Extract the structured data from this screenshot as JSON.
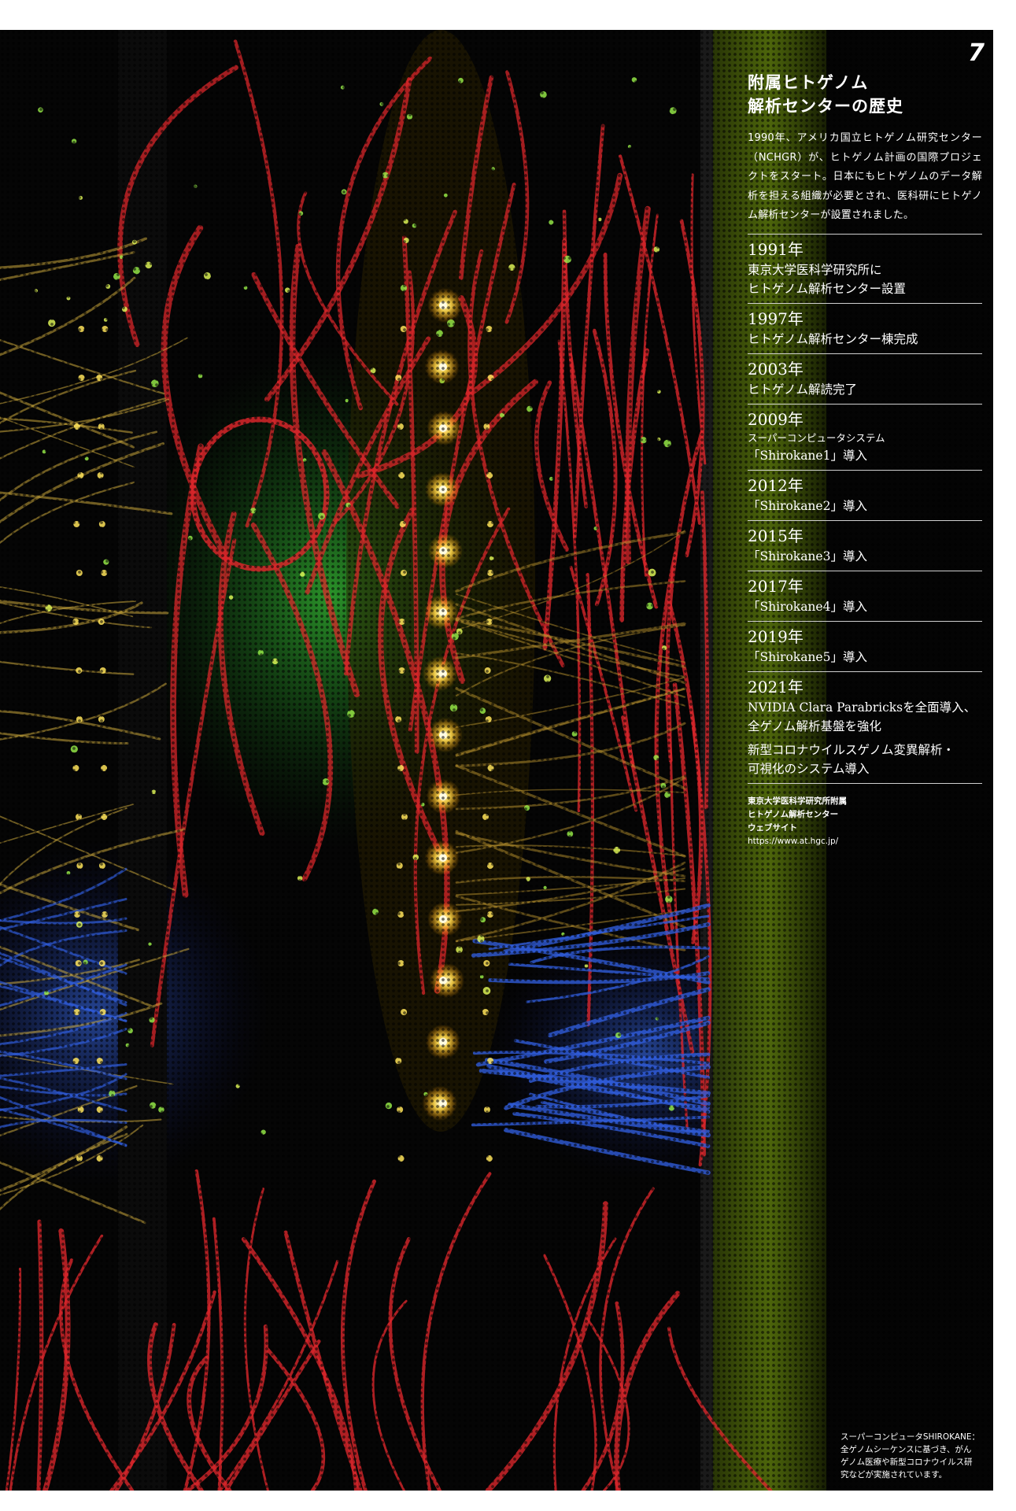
{
  "page_number": "7",
  "panel": {
    "title": "附属ヒトゲノム\n解析センターの歴史",
    "title_line1": "附属ヒトゲノム",
    "title_line2": "解析センターの歴史",
    "intro": "1990年、アメリカ国立ヒトゲノム研究センター（NCHGR）が、ヒトゲノム計画の国際プロジェクトをスタート。日本にもヒトゲノムのデータ解析を担える組織が必要とされ、医科研にヒトゲノム解析センターが設置されました。",
    "timeline": [
      {
        "year": "1991年",
        "text": "東京大学医科学研究所に\nヒトゲノム解析センター設置"
      },
      {
        "year": "1997年",
        "text": "ヒトゲノム解析センター棟完成"
      },
      {
        "year": "2003年",
        "text": "ヒトゲノム解読完了"
      },
      {
        "year": "2009年",
        "text_small": "スーパーコンピュータシステム",
        "text": "「Shirokane1」導入"
      },
      {
        "year": "2012年",
        "text": "「Shirokane2」導入"
      },
      {
        "year": "2015年",
        "text": "「Shirokane3」導入"
      },
      {
        "year": "2017年",
        "text": "「Shirokane4」導入"
      },
      {
        "year": "2019年",
        "text": "「Shirokane5」導入"
      },
      {
        "year": "2021年",
        "text": "NVIDIA Clara Parabricksを全面導入、\n全ゲノム解析基盤を強化",
        "extra": "新型コロナウイルスゲノム変異解析・\n可視化のシステム導入"
      }
    ],
    "source": {
      "line1": "東京大学医科学研究所附属",
      "line2": "ヒトゲノム解析センター",
      "line3": "ウェブサイト",
      "url": "https://www.at.hgc.jp/"
    }
  },
  "caption": {
    "line1": "スーパーコンピュータSHIROKANE：",
    "line2": "全ゲノムシーケンスに基づき、がん",
    "line3": "ゲノム医療や新型コロナウイルス研",
    "line4": "究などが実施されています。"
  },
  "photo": {
    "subject": "server-rack-with-cables-and-leds",
    "colors": {
      "background": "#050505",
      "red_cable": "#d8262a",
      "green_light": "#3ccf3a",
      "yellow_led": "#ffe45a",
      "blue_cable": "#2f5bd8"
    }
  }
}
